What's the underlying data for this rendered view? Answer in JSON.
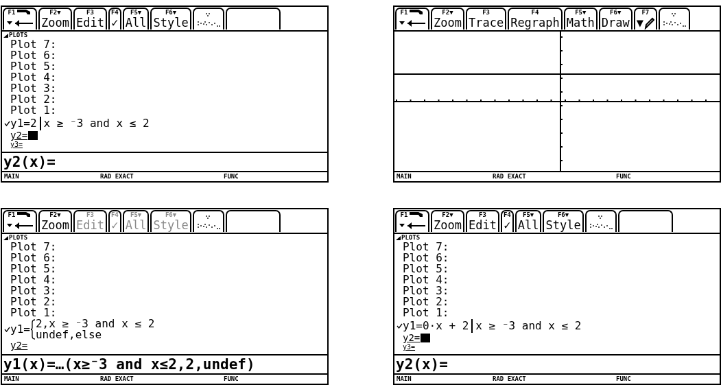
{
  "screens": [
    {
      "kind": "editor",
      "toolbar": [
        {
          "kind": "tool",
          "fkey": "F1",
          "disabled": false
        },
        {
          "kind": "text",
          "fkey": "F2▼",
          "label": "Zoom",
          "disabled": false
        },
        {
          "kind": "text",
          "fkey": "F3",
          "label": "Edit",
          "disabled": false
        },
        {
          "kind": "text",
          "fkey": "F4",
          "label": "✓",
          "disabled": false
        },
        {
          "kind": "text",
          "fkey": "F5▼",
          "label": "All",
          "disabled": false
        },
        {
          "kind": "text",
          "fkey": "F6▼",
          "label": "Style",
          "disabled": false
        },
        {
          "kind": "dotted",
          "disabled": true
        },
        {
          "kind": "empty"
        }
      ],
      "section": "PLOTS",
      "plots": [
        "Plot 7:",
        "Plot 6:",
        "Plot 5:",
        "Plot 4:",
        "Plot 3:",
        "Plot 2:",
        "Plot 1:"
      ],
      "functions": [
        {
          "kind": "inline",
          "name": "y1=",
          "checked": true,
          "cursor": false,
          "expr": "2",
          "condition": "x ≥ ⁻3 and x ≤ 2"
        },
        {
          "kind": "plain",
          "name": "y2=",
          "checked": false,
          "cursor": true
        },
        {
          "kind": "small",
          "name": "y3=",
          "checked": false,
          "cursor": false
        }
      ],
      "entry": "y2(x)=",
      "status": [
        "MAIN",
        "RAD EXACT",
        "FUNC"
      ]
    },
    {
      "kind": "graph",
      "toolbar": [
        {
          "kind": "tool",
          "fkey": "F1",
          "disabled": false
        },
        {
          "kind": "text",
          "fkey": "F2▼",
          "label": "Zoom",
          "disabled": false
        },
        {
          "kind": "text",
          "fkey": "F3",
          "label": "Trace",
          "disabled": false
        },
        {
          "kind": "text",
          "fkey": "F4",
          "label": "Regraph",
          "disabled": false
        },
        {
          "kind": "text",
          "fkey": "F5▼",
          "label": "Math",
          "disabled": false
        },
        {
          "kind": "text",
          "fkey": "F6▼",
          "label": "Draw",
          "disabled": false
        },
        {
          "kind": "pencil",
          "fkey": "F7",
          "label": "▼",
          "disabled": false
        },
        {
          "kind": "dotted",
          "disabled": true
        }
      ],
      "status": [
        "MAIN",
        "RAD EXACT",
        "FUNC"
      ]
    },
    {
      "kind": "editor",
      "toolbar": [
        {
          "kind": "tool",
          "fkey": "F1",
          "disabled": false
        },
        {
          "kind": "text",
          "fkey": "F2▼",
          "label": "Zoom",
          "disabled": false
        },
        {
          "kind": "text",
          "fkey": "F3",
          "label": "Edit",
          "disabled": true
        },
        {
          "kind": "text",
          "fkey": "F4",
          "label": "✓",
          "disabled": true
        },
        {
          "kind": "text",
          "fkey": "F5▼",
          "label": "All",
          "disabled": true
        },
        {
          "kind": "text",
          "fkey": "F6▼",
          "label": "Style",
          "disabled": true
        },
        {
          "kind": "dotted",
          "disabled": true
        },
        {
          "kind": "empty"
        }
      ],
      "section": "PLOTS",
      "plots": [
        "Plot 7:",
        "Plot 6:",
        "Plot 5:",
        "Plot 4:",
        "Plot 3:",
        "Plot 2:",
        "Plot 1:"
      ],
      "functions": [
        {
          "kind": "piecewise",
          "name": "y1=",
          "checked": true,
          "cursor": false,
          "cases": [
            "2,x ≥ ⁻3 and x ≤ 2",
            "undef,else"
          ]
        },
        {
          "kind": "plain",
          "name": "y2=",
          "checked": false,
          "cursor": false
        }
      ],
      "entry": "y1(x)=…(x≥⁻3 and x≤2,2,undef)",
      "status": [
        "MAIN",
        "RAD EXACT",
        "FUNC"
      ]
    },
    {
      "kind": "editor",
      "toolbar": [
        {
          "kind": "tool",
          "fkey": "F1",
          "disabled": false
        },
        {
          "kind": "text",
          "fkey": "F2▼",
          "label": "Zoom",
          "disabled": false
        },
        {
          "kind": "text",
          "fkey": "F3",
          "label": "Edit",
          "disabled": false
        },
        {
          "kind": "text",
          "fkey": "F4",
          "label": "✓",
          "disabled": false
        },
        {
          "kind": "text",
          "fkey": "F5▼",
          "label": "All",
          "disabled": false
        },
        {
          "kind": "text",
          "fkey": "F6▼",
          "label": "Style",
          "disabled": false
        },
        {
          "kind": "dotted",
          "disabled": true
        },
        {
          "kind": "empty"
        }
      ],
      "section": "PLOTS",
      "plots": [
        "Plot 7:",
        "Plot 6:",
        "Plot 5:",
        "Plot 4:",
        "Plot 3:",
        "Plot 2:",
        "Plot 1:"
      ],
      "functions": [
        {
          "kind": "inline",
          "name": "y1=",
          "checked": true,
          "cursor": false,
          "expr": "0·x + 2",
          "condition": "x ≥ ⁻3 and x ≤ 2"
        },
        {
          "kind": "plain",
          "name": "y2=",
          "checked": false,
          "cursor": true
        },
        {
          "kind": "small",
          "name": "y3=",
          "checked": false,
          "cursor": false
        }
      ],
      "entry": "y2(x)=",
      "status": [
        "MAIN",
        "RAD EXACT",
        "FUNC"
      ]
    }
  ]
}
